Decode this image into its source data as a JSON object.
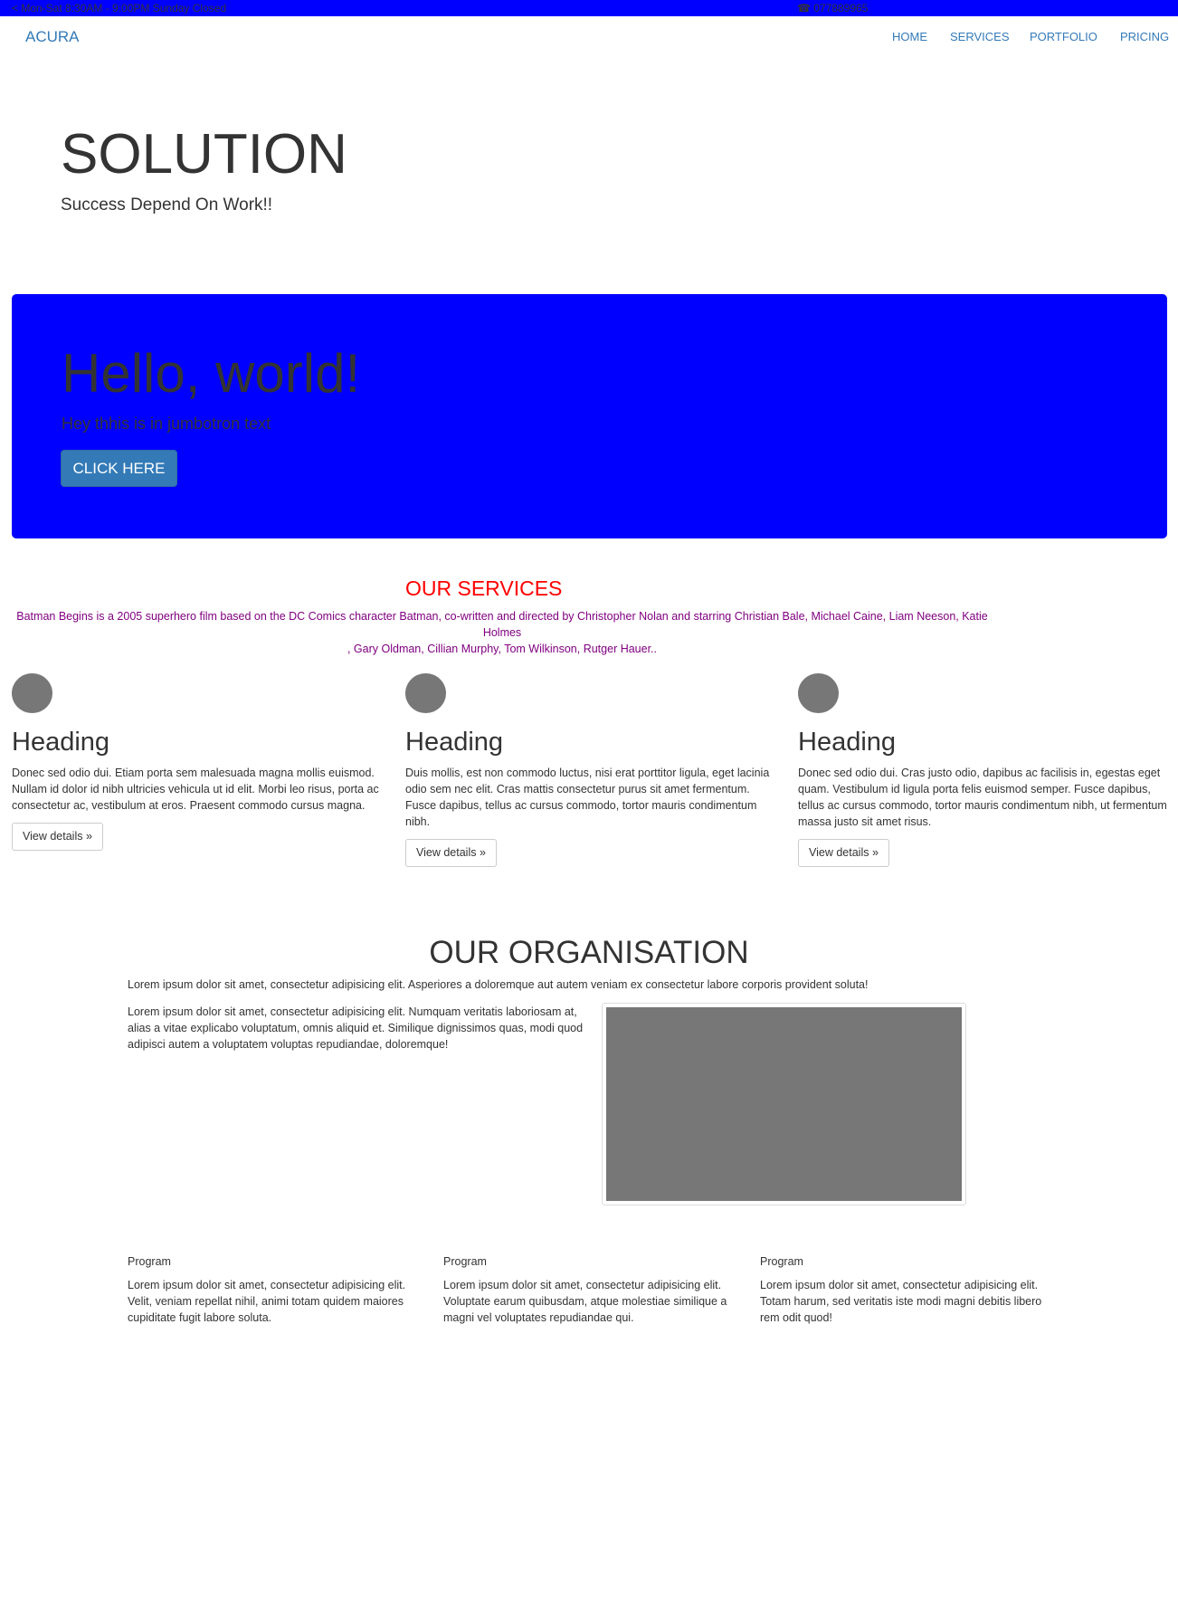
{
  "topbar": {
    "hours": "< Mon-Sat 8:30AM - 9:00PM Sunday Closed",
    "phone_icon": "phone-icon",
    "phone": "☎ 077889965"
  },
  "navbar": {
    "brand": "ACURA",
    "items": [
      "HOME",
      "SERVICES",
      "PORTFOLIO",
      "PRICING"
    ]
  },
  "hero": {
    "title": "SOLUTION",
    "subtitle": "Success Depend On Work!!"
  },
  "jumbotron": {
    "title": "Hello, world!",
    "text": "Hey thhis is in jumbotron text",
    "button": "CLICK HERE"
  },
  "services": {
    "title": "OUR SERVICES",
    "description_line1": "Batman Begins is a 2005 superhero film based on the DC Comics character Batman, co-written and directed by Christopher Nolan and starring Christian Bale, Michael Caine, Liam Neeson, Katie Holmes",
    "description_line2": ", Gary Oldman, Cillian Murphy, Tom Wilkinson, Rutger Hauer..",
    "items": [
      {
        "heading": "Heading",
        "text": "Donec sed odio dui. Etiam porta sem malesuada magna mollis euismod. Nullam id dolor id nibh ultricies vehicula ut id elit. Morbi leo risus, porta ac consectetur ac, vestibulum at eros. Praesent commodo cursus magna.",
        "button": "View details »"
      },
      {
        "heading": "Heading",
        "text": "Duis mollis, est non commodo luctus, nisi erat porttitor ligula, eget lacinia odio sem nec elit. Cras mattis consectetur purus sit amet fermentum. Fusce dapibus, tellus ac cursus commodo, tortor mauris condimentum nibh.",
        "button": "View details »"
      },
      {
        "heading": "Heading",
        "text": "Donec sed odio dui. Cras justo odio, dapibus ac facilisis in, egestas eget quam. Vestibulum id ligula porta felis euismod semper. Fusce dapibus, tellus ac cursus commodo, tortor mauris condimentum nibh, ut fermentum massa justo sit amet risus.",
        "button": "View details »"
      }
    ]
  },
  "organisation": {
    "title": "OUR ORGANISATION",
    "lead": "Lorem ipsum dolor sit amet, consectetur adipisicing elit. Asperiores a doloremque aut autem veniam ex consectetur labore corporis provident soluta!",
    "text": "Lorem ipsum dolor sit amet, consectetur adipisicing elit. Numquam veritatis laboriosam at, alias a vitae explicabo voluptatum, omnis aliquid et. Similique dignissimos quas, modi quod adipisci autem a voluptatem voluptas repudiandae, doloremque!"
  },
  "programs": [
    {
      "title": "Program",
      "text": "Lorem ipsum dolor sit amet, consectetur adipisicing elit. Velit, veniam repellat nihil, animi totam quidem maiores cupiditate fugit labore soluta."
    },
    {
      "title": "Program",
      "text": "Lorem ipsum dolor sit amet, consectetur adipisicing elit. Voluptate earum quibusdam, atque molestiae similique a magni vel voluptates repudiandae qui."
    },
    {
      "title": "Program",
      "text": "Lorem ipsum dolor sit amet, consectetur adipisicing elit. Totam harum, sed veritatis iste modi magni debitis libero rem odit quod!"
    }
  ]
}
